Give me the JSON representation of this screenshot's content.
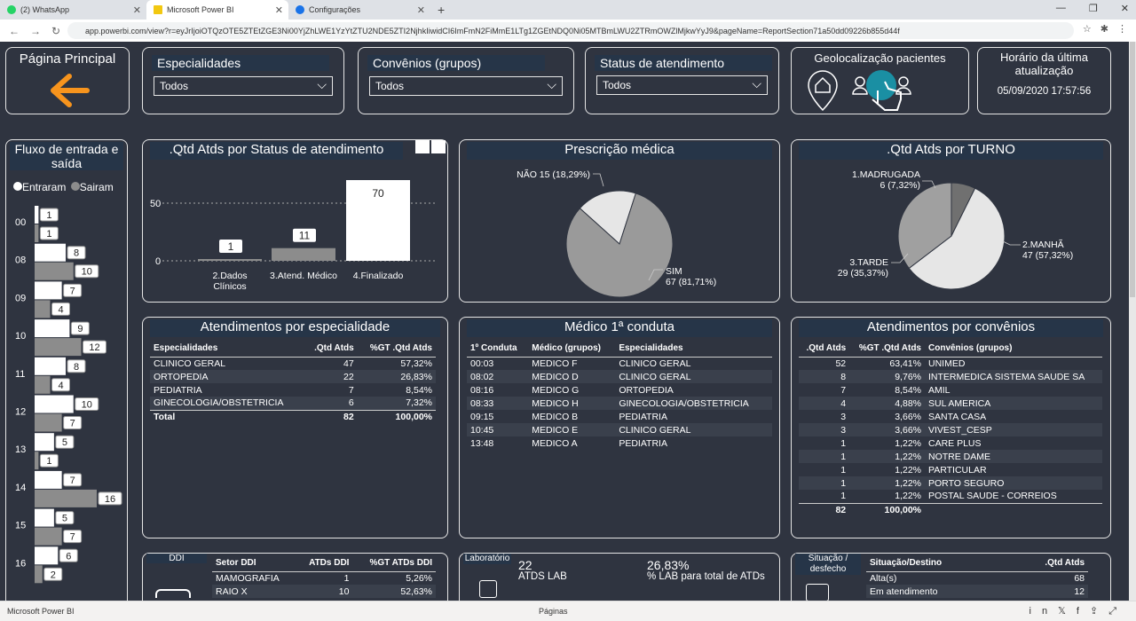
{
  "browser": {
    "tabs": [
      {
        "label": "(2) WhatsApp",
        "color": "#25d366"
      },
      {
        "label": "Microsoft Power BI",
        "color": "#f2c811"
      },
      {
        "label": "Configurações",
        "color": "#1a73e8"
      }
    ],
    "url": "app.powerbi.com/view?r=eyJrIjoiOTQzOTE5ZTEtZGE3Ni00YjZhLWE1YzYtZTU2NDE5ZTI2NjhkIiwidCI6ImFmN2FiMmE1LTg1ZGEtNDQ0Ni05MTBmLWU2ZTRmOWZlMjkwYyJ9&pageName=ReportSection71a50dd09226b855d44f"
  },
  "nav": {
    "home_label": "Página Principal"
  },
  "slicers": [
    {
      "title": "Especialidades",
      "value": "Todos"
    },
    {
      "title": "Convênios (grupos)",
      "value": "Todos"
    },
    {
      "title": "Status de atendimento",
      "value": "Todos"
    }
  ],
  "geo": {
    "title": "Geolocalização pacientes"
  },
  "update": {
    "title": "Horário da última atualização",
    "value": "05/09/2020 17:57:56"
  },
  "flow": {
    "title": "Fluxo de entrada e saída",
    "legend_in": "Entraram",
    "legend_out": "Sairam",
    "hours": [
      {
        "h": "00",
        "in": 1,
        "out": 1
      },
      {
        "h": "08",
        "in": 8,
        "out": 10
      },
      {
        "h": "09",
        "in": 7,
        "out": 4
      },
      {
        "h": "10",
        "in": 9,
        "out": 12
      },
      {
        "h": "11",
        "in": 8,
        "out": 4
      },
      {
        "h": "12",
        "in": 10,
        "out": 7
      },
      {
        "h": "13",
        "in": 5,
        "out": 1
      },
      {
        "h": "14",
        "in": 7,
        "out": 16
      },
      {
        "h": "15",
        "in": 5,
        "out": 7
      },
      {
        "h": "16",
        "in": 6,
        "out": 2
      }
    ]
  },
  "status_chart": {
    "title": ".Qtd Atds por Status de atendimento"
  },
  "prescricao": {
    "title": "Prescrição médica"
  },
  "turno": {
    "title": ".Qtd Atds por TURNO"
  },
  "chart_data": [
    {
      "type": "bar",
      "title": ".Qtd Atds por Status de atendimento",
      "categories": [
        "2.Dados Clínicos",
        "3.Atend. Médico",
        "4.Finalizado"
      ],
      "values": [
        1,
        11,
        70
      ],
      "yticks": [
        0,
        50
      ]
    },
    {
      "type": "pie",
      "title": "Prescrição médica",
      "labels": [
        "NÃO",
        "SIM"
      ],
      "values": [
        15,
        67
      ],
      "pct": [
        "18,29%",
        "81,71%"
      ]
    },
    {
      "type": "pie",
      "title": ".Qtd Atds por TURNO",
      "labels": [
        "1.MADRUGADA",
        "2.MANHÃ",
        "3.TARDE"
      ],
      "values": [
        6,
        47,
        29
      ],
      "pct": [
        "7,32%",
        "57,32%",
        "35,37%"
      ]
    }
  ],
  "especialidade": {
    "title": "Atendimentos por especialidade",
    "headers": [
      "Especialidades",
      ".Qtd Atds",
      "%GT .Qtd Atds"
    ],
    "rows": [
      [
        "CLINICO GERAL",
        "47",
        "57,32%"
      ],
      [
        "ORTOPEDIA",
        "22",
        "26,83%"
      ],
      [
        "PEDIATRIA",
        "7",
        "8,54%"
      ],
      [
        "GINECOLOGIA/OBSTETRICIA",
        "6",
        "7,32%"
      ]
    ],
    "total": [
      "Total",
      "82",
      "100,00%"
    ]
  },
  "medico": {
    "title": "Médico 1ª conduta",
    "headers": [
      "1º Conduta",
      "Médico (grupos)",
      "Especialidades"
    ],
    "rows": [
      [
        "00:03",
        "MEDICO F",
        "CLINICO GERAL"
      ],
      [
        "08:02",
        "MEDICO D",
        "CLINICO GERAL"
      ],
      [
        "08:16",
        "MEDICO G",
        "ORTOPEDIA"
      ],
      [
        "08:33",
        "MEDICO H",
        "GINECOLOGIA/OBSTETRICIA"
      ],
      [
        "09:15",
        "MEDICO B",
        "PEDIATRIA"
      ],
      [
        "10:45",
        "MEDICO E",
        "CLINICO GERAL"
      ],
      [
        "13:48",
        "MEDICO A",
        "PEDIATRIA"
      ]
    ]
  },
  "convenio": {
    "title": "Atendimentos por convênios",
    "headers": [
      ".Qtd Atds",
      "%GT .Qtd Atds",
      "Convênios (grupos)"
    ],
    "rows": [
      [
        "52",
        "63,41%",
        "UNIMED"
      ],
      [
        "8",
        "9,76%",
        "INTERMEDICA SISTEMA SAUDE SA"
      ],
      [
        "7",
        "8,54%",
        "AMIL"
      ],
      [
        "4",
        "4,88%",
        "SUL AMERICA"
      ],
      [
        "3",
        "3,66%",
        "SANTA CASA"
      ],
      [
        "3",
        "3,66%",
        "VIVEST_CESP"
      ],
      [
        "1",
        "1,22%",
        "CARE PLUS"
      ],
      [
        "1",
        "1,22%",
        "NOTRE DAME"
      ],
      [
        "1",
        "1,22%",
        "PARTICULAR"
      ],
      [
        "1",
        "1,22%",
        "PORTO SEGURO"
      ],
      [
        "1",
        "1,22%",
        "POSTAL SAUDE - CORREIOS"
      ]
    ],
    "total": [
      "82",
      "100,00%",
      ""
    ]
  },
  "ddi": {
    "title": "DDI",
    "headers": [
      "Setor DDI",
      "ATDs DDI",
      "%GT ATDs DDI"
    ],
    "rows": [
      [
        "MAMOGRAFIA",
        "1",
        "5,26%"
      ],
      [
        "RAIO X",
        "10",
        "52,63%"
      ]
    ]
  },
  "lab": {
    "title": "Laboratório",
    "count": "22",
    "count_label": "ATDS LAB",
    "pct": "26,83%",
    "pct_label": "% LAB para total de ATDs"
  },
  "situacao": {
    "title": "Situação / desfecho",
    "headers": [
      "Situação/Destino",
      ".Qtd Atds"
    ],
    "rows": [
      [
        "Alta(s)",
        "68"
      ],
      [
        "Em atendimento",
        "12"
      ]
    ]
  },
  "footer": {
    "app": "Microsoft Power BI",
    "pages": "Páginas"
  },
  "colors": {
    "bg": "#2f3440",
    "header": "#263548",
    "bar_gray": "#8c8c8c",
    "bar_white": "#ffffff",
    "accent": "#f7941d",
    "teal": "#1a8fa3"
  }
}
